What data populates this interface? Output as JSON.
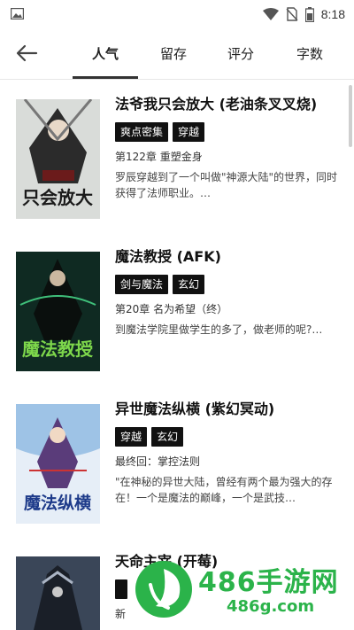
{
  "status_bar": {
    "time": "8:18",
    "icons": [
      "image-icon",
      "wifi-icon",
      "no-sim-icon",
      "battery-icon"
    ]
  },
  "nav": {
    "tabs": [
      {
        "label": "人气"
      },
      {
        "label": "留存"
      },
      {
        "label": "评分"
      },
      {
        "label": "字数"
      }
    ],
    "active_tab": "人气"
  },
  "books": [
    {
      "title": "法爷我只会放大 (老油条叉叉烧)",
      "tags": [
        "爽点密集",
        "穿越"
      ],
      "chapter": "第122章 重塑金身",
      "desc": "罗辰穿越到了一个叫做\"神源大陆\"的世界，同时获得了法师职业。…",
      "cover_text": "只会放大"
    },
    {
      "title": "魔法教授 (AFK)",
      "tags": [
        "剑与魔法",
        "玄幻"
      ],
      "chapter": "第20章 名为希望（终）",
      "desc": "到魔法学院里做学生的多了，做老师的呢?…",
      "cover_text": "魔法教授"
    },
    {
      "title": "异世魔法纵横 (紫幻冥动)",
      "tags": [
        "穿越",
        "玄幻"
      ],
      "chapter": "最终回：掌控法则",
      "desc": "\"在神秘的异世大陆，曾经有两个最为强大的存在！一个是魔法的巅峰，一个是武技…",
      "cover_text": "魔法纵横"
    },
    {
      "title": "天命主宰 (开莓)",
      "tags": [
        ""
      ],
      "chapter": "新",
      "desc": "",
      "cover_text": ""
    }
  ],
  "watermark": {
    "text": "486手游网",
    "sub": "486g.com"
  }
}
